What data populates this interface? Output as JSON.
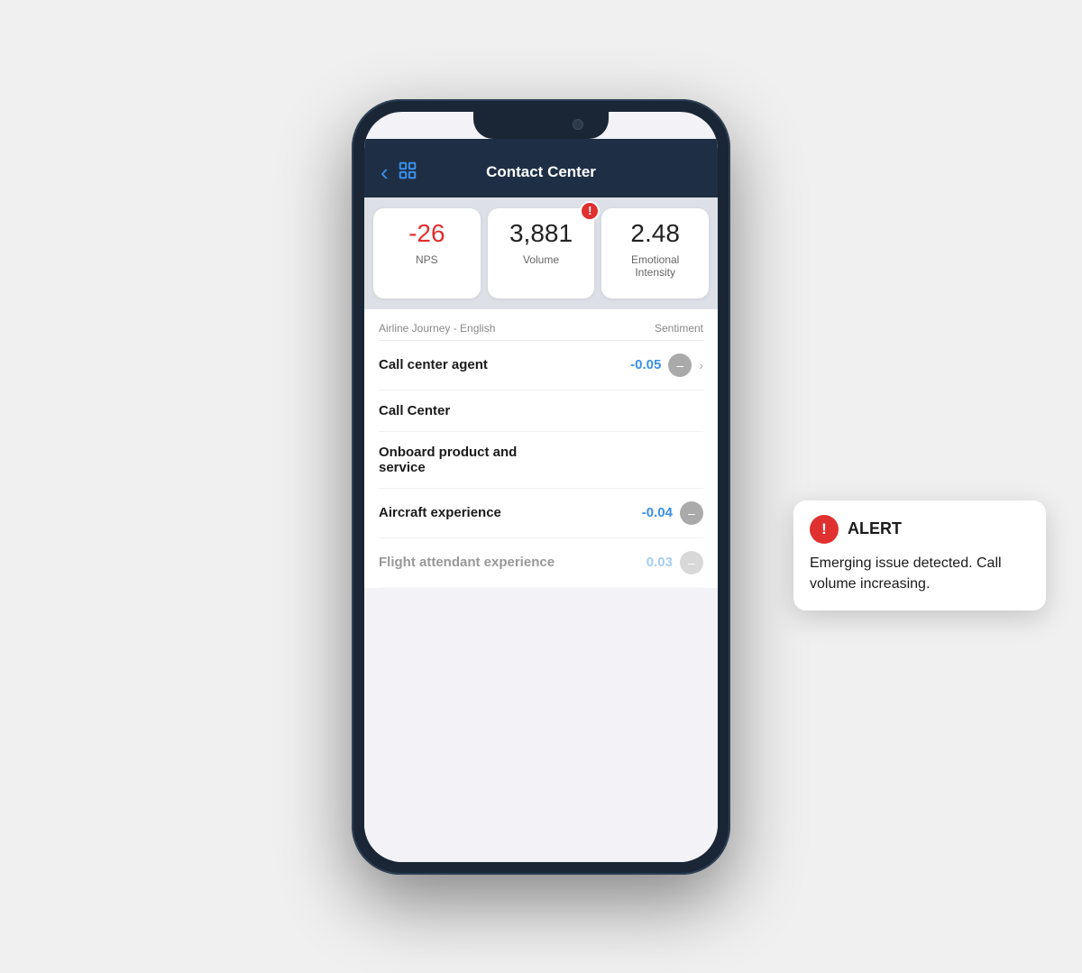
{
  "header": {
    "title": "Contact Center",
    "back_label": "‹",
    "grid_icon": "grid"
  },
  "metrics": [
    {
      "value": "-26",
      "label": "NPS",
      "negative": true,
      "has_alert": false
    },
    {
      "value": "3,881",
      "label": "Volume",
      "negative": false,
      "has_alert": true
    },
    {
      "value": "2.48",
      "label": "Emotional Intensity",
      "negative": false,
      "has_alert": false
    }
  ],
  "list": {
    "column_left": "Airline Journey - English",
    "column_right": "Sentiment",
    "items": [
      {
        "label": "Call center agent",
        "sentiment": "-0.05",
        "show_chevron": true,
        "blurred": false
      },
      {
        "label": "Call Center",
        "sentiment": "",
        "show_chevron": false,
        "blurred": false
      },
      {
        "label": "Onboard product and service",
        "sentiment": "",
        "show_chevron": false,
        "blurred": false
      },
      {
        "label": "Aircraft experience",
        "sentiment": "-0.04",
        "show_chevron": false,
        "blurred": false
      },
      {
        "label": "Flight attendant experience",
        "sentiment": "0.03",
        "show_chevron": false,
        "blurred": true
      }
    ]
  },
  "alert_popup": {
    "title": "ALERT",
    "message": "Emerging issue detected. Call volume increasing."
  }
}
